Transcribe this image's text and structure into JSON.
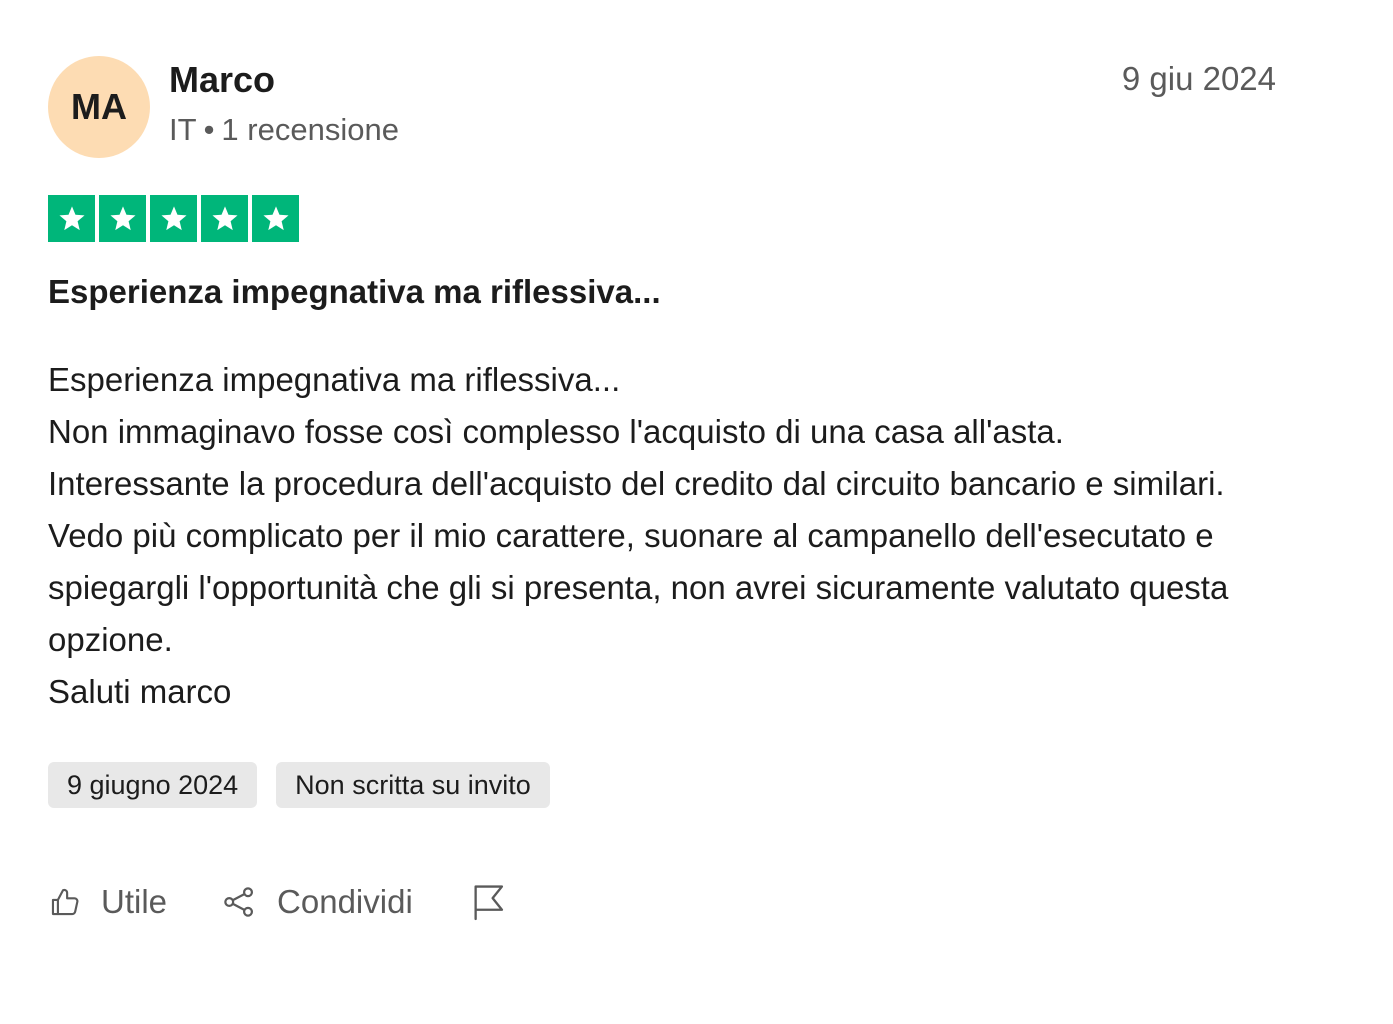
{
  "review": {
    "avatar_initials": "MA",
    "reviewer_name": "Marco",
    "reviewer_country": "IT",
    "reviewer_separator": "•",
    "reviewer_review_count": "1 recensione",
    "date_short": "9 giu 2024",
    "rating": 5,
    "rating_max": 5,
    "star_color": "#00b67a",
    "title": "Esperienza impegnativa ma riflessiva...",
    "body_lines": [
      "Esperienza impegnativa ma riflessiva...",
      "Non immaginavo fosse così complesso l'acquisto di una casa all'asta.",
      "Interessante la procedura dell'acquisto del credito dal circuito bancario e similari.",
      "Vedo più complicato per il mio carattere, suonare al campanello dell'esecutato e spiegargli l'opportunità che gli si presenta, non avrei sicuramente valutato questa opzione.",
      "Saluti marco"
    ],
    "tags": {
      "experience_date": "9 giugno 2024",
      "invitation_status": "Non scritta su invito"
    }
  },
  "actions": {
    "like_label": "Utile",
    "like_icon": "thumbs-up-icon",
    "share_label": "Condividi",
    "share_icon": "share-icon",
    "report_icon": "flag-icon"
  },
  "colors": {
    "avatar_bg": "#fddcb3",
    "tag_bg": "#e8e8e8",
    "text_primary": "#1c1c1c",
    "text_secondary": "#5a5a5a"
  }
}
